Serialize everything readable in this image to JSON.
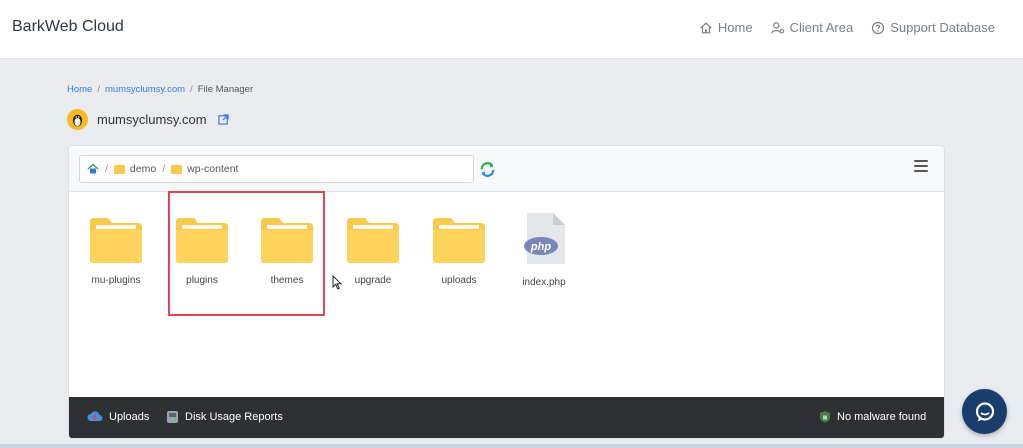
{
  "header": {
    "brand": "BarkWeb Cloud",
    "nav": [
      {
        "label": "Home",
        "icon": "home-icon"
      },
      {
        "label": "Client Area",
        "icon": "user-gear-icon"
      },
      {
        "label": "Support Database",
        "icon": "help-circle-icon"
      }
    ]
  },
  "breadcrumb": {
    "home": "Home",
    "domain": "mumsyclumsy.com",
    "current": "File Manager"
  },
  "domain": {
    "name": "mumsyclumsy.com"
  },
  "file_manager": {
    "path": [
      {
        "label": "demo"
      },
      {
        "label": "wp-content"
      }
    ],
    "files": [
      {
        "name": "mu-plugins",
        "type": "folder"
      },
      {
        "name": "plugins",
        "type": "folder"
      },
      {
        "name": "themes",
        "type": "folder"
      },
      {
        "name": "upgrade",
        "type": "folder"
      },
      {
        "name": "uploads",
        "type": "folder"
      },
      {
        "name": "index.php",
        "type": "php",
        "badge": "php"
      }
    ],
    "footer": {
      "uploads": "Uploads",
      "disk_usage": "Disk Usage Reports",
      "malware": "No malware found"
    }
  },
  "colors": {
    "accent": "#3a7bd5",
    "folder": "#f8c94b",
    "highlight": "#e0454d",
    "footer_bg": "#2f3033",
    "chat": "#1a3d6d"
  }
}
